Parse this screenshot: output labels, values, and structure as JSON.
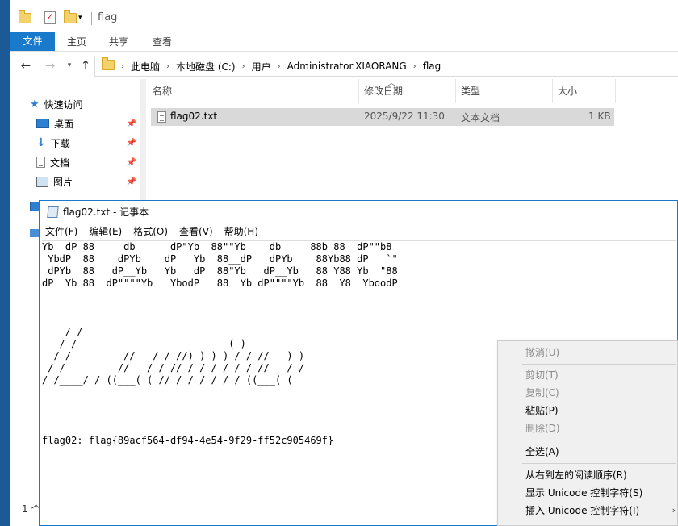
{
  "explorer": {
    "title": "flag",
    "ribbon_tabs": [
      "文件",
      "主页",
      "共享",
      "查看"
    ],
    "breadcrumb": [
      "此电脑",
      "本地磁盘 (C:)",
      "用户",
      "Administrator.XIAORANG",
      "flag"
    ],
    "nav_items": [
      {
        "label": "快速访问",
        "icon": "star-icon"
      },
      {
        "label": "桌面",
        "icon": "desktop-icon"
      },
      {
        "label": "下载",
        "icon": "download-arrow-icon"
      },
      {
        "label": "文档",
        "icon": "document-icon"
      },
      {
        "label": "图片",
        "icon": "pictures-icon"
      }
    ],
    "columns": [
      "名称",
      "修改日期",
      "类型",
      "大小"
    ],
    "files": [
      {
        "name": "flag02.txt",
        "modified": "2025/9/22 11:30",
        "type": "文本文档",
        "size": "1 KB"
      }
    ],
    "status": "1 个"
  },
  "notepad": {
    "title": "flag02.txt - 记事本",
    "menu": [
      "文件(F)",
      "编辑(E)",
      "格式(O)",
      "查看(V)",
      "帮助(H)"
    ],
    "content": "Yb  dP 88     db      dP\"Yb  88\"\"Yb    db     88b 88  dP\"\"b8\n YbdP  88    dPYb    dP   Yb  88__dP   dPYb    88Yb88 dP   `\"\n dPYb  88   dP__Yb   Yb   dP  88\"Yb   dP__Yb   88 Y88 Yb  \"88\ndP  Yb 88  dP\"\"\"\"Yb   YbodP   88  Yb dP\"\"\"\"Yb  88  Y8  YboodP\n\n\n\n    / /                                         \n   / /                  ___     ( )  ___        \n  / /         //   / / //) ) ) ) / / //   ) )   \n / /         //   / / // / / / / / / //   / /    \n/ /____/ / ((___( ( // / / / / / / ((___( (      \n\n\n\n\nflag02: flag{89acf564-df94-4e54-9f29-ff52c905469f}"
  },
  "context_menu": {
    "items": [
      {
        "label": "撤消(U)",
        "enabled": false
      },
      {
        "label": "剪切(T)",
        "enabled": false
      },
      {
        "label": "复制(C)",
        "enabled": false
      },
      {
        "label": "粘贴(P)",
        "enabled": true
      },
      {
        "label": "删除(D)",
        "enabled": false
      },
      {
        "label": "全选(A)",
        "enabled": true
      },
      {
        "label": "从右到左的阅读顺序(R)",
        "enabled": true
      },
      {
        "label": "显示 Unicode 控制字符(S)",
        "enabled": true
      },
      {
        "label": "插入 Unicode 控制字符(I)",
        "enabled": true
      }
    ]
  },
  "colors": {
    "accent": "#1979ca",
    "desktop": "#1b5a96",
    "selected_row": "#d9d9d9"
  }
}
